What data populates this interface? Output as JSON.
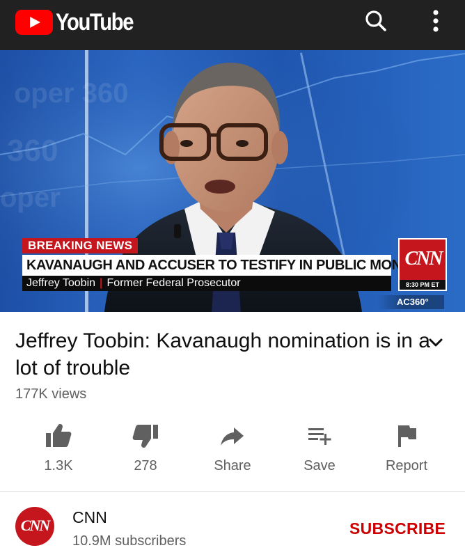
{
  "app": {
    "name": "YouTube"
  },
  "appbar": {
    "search_icon": "search-icon",
    "more_icon": "more-vert-icon"
  },
  "video": {
    "overlay": {
      "breaking": "BREAKING NEWS",
      "headline": "KAVANAUGH AND ACCUSER TO TESTIFY IN PUBLIC MONDAY",
      "name": "Jeffrey Toobin",
      "role": "Former Federal Prosecutor",
      "network_logo": "CNN",
      "time": "8:30 PM ET",
      "show": "AC360°"
    },
    "title": "Jeffrey Toobin: Kavanaugh nomination is in a lot of trouble",
    "views": "177K views"
  },
  "actions": [
    {
      "icon": "thumbs-up-icon",
      "label": "1.3K"
    },
    {
      "icon": "thumbs-down-icon",
      "label": "278"
    },
    {
      "icon": "share-icon",
      "label": "Share"
    },
    {
      "icon": "playlist-add-icon",
      "label": "Save"
    },
    {
      "icon": "flag-icon",
      "label": "Report"
    }
  ],
  "channel": {
    "avatar_text": "CNN",
    "name": "CNN",
    "subscribers": "10.9M subscribers",
    "subscribe_label": "SUBSCRIBE"
  },
  "colors": {
    "appbar": "#212121",
    "brand_red": "#ff0000",
    "subscribe": "#cc0000",
    "cnn_red": "#c4161c"
  }
}
